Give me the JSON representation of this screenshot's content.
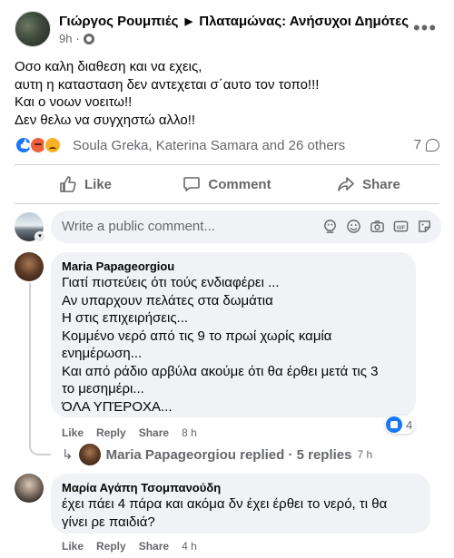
{
  "post": {
    "author": "Γιώργος Ρουμπιές",
    "group": "Πλαταμώνας: Ανήσυχοι Δημότες",
    "time": "9h",
    "lines": [
      "Οσο καλη διαθεση και να εχεις,",
      "αυτη η κατασταση δεν αντεχεται σ΄αυτο τον τοπο!!!",
      "Και ο νοων νοειτω!!",
      "Δεν θελω να συγχηστώ αλλο!!"
    ],
    "reactions_text": "Soula Greka, Katerina Samara and 26 others",
    "comment_count": "7"
  },
  "actions": {
    "like": "Like",
    "comment": "Comment",
    "share": "Share"
  },
  "write_comment": {
    "placeholder": "Write a public comment..."
  },
  "comments": [
    {
      "name": "Maria Papageorgiou",
      "lines": [
        "Γιατί πιστεύεις ότι τούς ενδιαφέρει ...",
        "Αν υπαρχουν πελάτες στα δωμάτια",
        "Η στις επιχειρήσεις...",
        "Κομμένο νερό από τις 9 το πρωί χωρίς καμία",
        "ενημέρωση...",
        "Και από ράδιο αρβύλα ακούμε ότι θα έρθει μετά τις 3",
        "το μεσημέρι...",
        "ΌΛΑ ΥΠΈΡΟΧΑ..."
      ],
      "like": "Like",
      "reply": "Reply",
      "share": "Share",
      "time": "8 h",
      "like_count": "4",
      "replied_text": "Maria Papageorgiou replied · 5 replies",
      "replied_time": "7 h"
    },
    {
      "name": "Μαρία Αγάπη Τσομπανούδη",
      "lines": [
        "έχει πάει 4 πάρα και ακόμα δν έχει έρθει το νερό, τι θα",
        "γίνει ρε παιδιά?"
      ],
      "like": "Like",
      "reply": "Reply",
      "share": "Share",
      "time": "4 h"
    }
  ]
}
